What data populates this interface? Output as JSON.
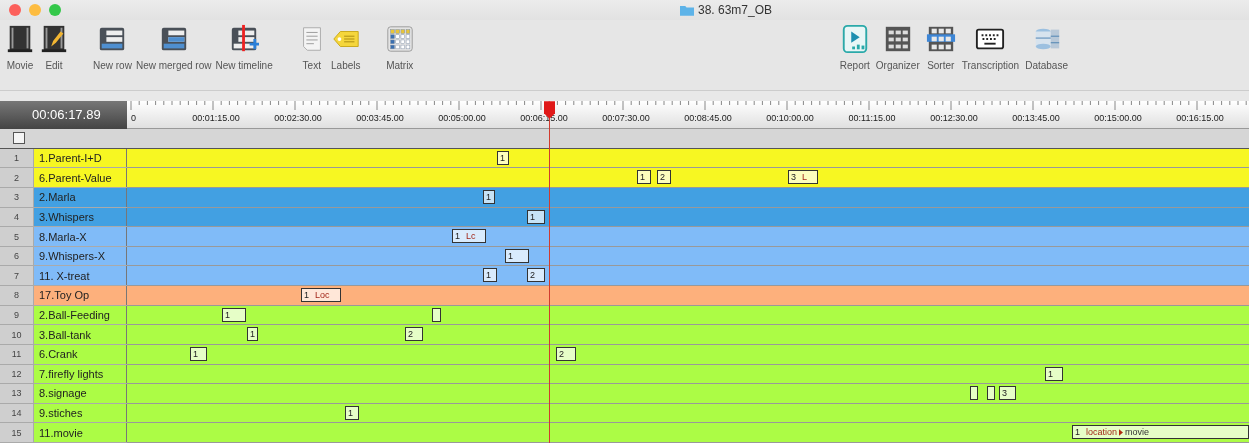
{
  "window": {
    "title": "38. 63m7_OB"
  },
  "toolbar": {
    "left_groups": [
      [
        {
          "label": "Movie",
          "kind": "film"
        },
        {
          "label": "Edit",
          "kind": "film-edit"
        }
      ],
      [
        {
          "label": "New row",
          "kind": "row"
        },
        {
          "label": "New merged row",
          "kind": "merged"
        },
        {
          "label": "New timeline",
          "kind": "timeline"
        }
      ],
      [
        {
          "label": "Text",
          "kind": "text"
        },
        {
          "label": "Labels",
          "kind": "tag"
        }
      ],
      [
        {
          "label": "Matrix",
          "kind": "matrix"
        }
      ]
    ],
    "right": [
      {
        "label": "Report",
        "kind": "report"
      },
      {
        "label": "Organizer",
        "kind": "organizer"
      },
      {
        "label": "Sorter",
        "kind": "sorter"
      },
      {
        "label": "Transcription",
        "kind": "keyboard"
      },
      {
        "label": "Database",
        "kind": "database"
      }
    ]
  },
  "current_time": "00:06:17.89",
  "ruler_labels": [
    "0",
    "00:01:15.00",
    "00:02:30.00",
    "00:03:45.00",
    "00:05:00.00",
    "00:06:15.00",
    "00:07:30.00",
    "00:08:45.00",
    "00:10:00.00",
    "00:11:15.00",
    "00:12:30.00",
    "00:13:45.00",
    "00:15:00.00",
    "00:16:15.00"
  ],
  "select_all": {
    "checked": false
  },
  "rows": [
    {
      "number": "1",
      "name": "1.Parent-I+D",
      "color": "#f7f722",
      "events": [
        {
          "label": "1"
        }
      ]
    },
    {
      "number": "2",
      "name": "6.Parent-Value",
      "color": "#f7f722",
      "events": [
        {
          "label": "1"
        },
        {
          "label": "2"
        },
        {
          "label": "3",
          "code": "L"
        }
      ]
    },
    {
      "number": "3",
      "name": "2.Marla",
      "color": "#42a0e2",
      "events": [
        {
          "label": "1"
        }
      ]
    },
    {
      "number": "4",
      "name": "3.Whispers",
      "color": "#42a0e2",
      "events": [
        {
          "label": "1"
        }
      ]
    },
    {
      "number": "5",
      "name": "8.Marla-X",
      "color": "#80bbf8",
      "events": [
        {
          "label": "1",
          "code": "Lc"
        }
      ]
    },
    {
      "number": "6",
      "name": "9.Whispers-X",
      "color": "#80bbf8",
      "events": [
        {
          "label": "1"
        }
      ]
    },
    {
      "number": "7",
      "name": "11. X-treat",
      "color": "#80bbf8",
      "events": [
        {
          "label": "1"
        },
        {
          "label": "2"
        }
      ]
    },
    {
      "number": "8",
      "name": "17.Toy Op",
      "color": "#fdb07c",
      "events": [
        {
          "label": "1",
          "code": "Loc"
        }
      ]
    },
    {
      "number": "9",
      "name": "2.Ball-Feeding",
      "color": "#acfc45",
      "events": [
        {
          "kind": "labeled",
          "label": "1"
        },
        {
          "kind": "blank"
        }
      ]
    },
    {
      "number": "10",
      "name": "3.Ball-tank",
      "color": "#acfc45",
      "events": [
        {
          "label": "1"
        },
        {
          "label": "2"
        }
      ]
    },
    {
      "number": "11",
      "name": "6.Crank",
      "color": "#acfc45",
      "events": [
        {
          "label": "1"
        },
        {
          "label": "2"
        }
      ]
    },
    {
      "number": "12",
      "name": "7.firefly lights",
      "color": "#acfc45",
      "events": [
        {
          "label": "1"
        }
      ]
    },
    {
      "number": "13",
      "name": "8.signage",
      "color": "#acfc45",
      "events": [
        {
          "kind": "blank"
        },
        {
          "kind": "blank"
        },
        {
          "kind": "labeled",
          "label": "3"
        }
      ]
    },
    {
      "number": "14",
      "name": "9.stiches",
      "color": "#acfc45",
      "events": [
        {
          "label": "1"
        }
      ]
    },
    {
      "number": "15",
      "name": "11.movie",
      "color": "#acfc45",
      "events": [
        {
          "label": "1",
          "path": [
            "location",
            "movie"
          ]
        }
      ]
    }
  ]
}
